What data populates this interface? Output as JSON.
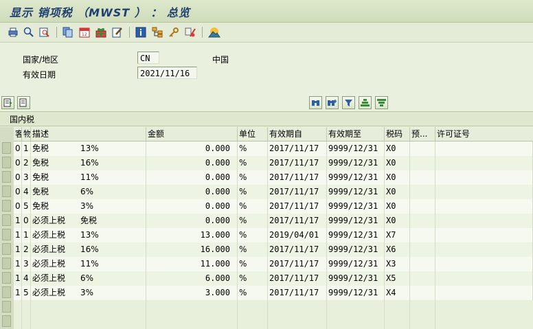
{
  "title": "显示 销项税 （MWST ） ： 总览",
  "toolbar": {
    "icons": [
      "print-icon",
      "find-icon",
      "find-next-icon",
      "copy-icon",
      "calendar-icon",
      "gift-icon",
      "edit-icon",
      "info-icon",
      "structure-icon",
      "key-icon",
      "calculate-icon",
      "mountain-icon"
    ]
  },
  "form": {
    "country_label": "国家/地区",
    "country_value": "CN",
    "country_name": "中国",
    "date_label": "有效日期",
    "date_value": "2021/11/16"
  },
  "section_title": "国内税",
  "columns": {
    "c1": "客",
    "c2": "物",
    "desc": "描述",
    "amount": "金额",
    "unit": "单位",
    "valid_from": "有效期自",
    "valid_to": "有效期至",
    "tax_code": "税码",
    "pre": "预...",
    "license": "许可证号"
  },
  "rows": [
    {
      "c1": "0",
      "c2": "1",
      "d1": "免税",
      "d2": "13%",
      "amount": "0.000",
      "unit": "%",
      "from": "2017/11/17",
      "to": "9999/12/31",
      "code": "X0"
    },
    {
      "c1": "0",
      "c2": "2",
      "d1": "免税",
      "d2": "16%",
      "amount": "0.000",
      "unit": "%",
      "from": "2017/11/17",
      "to": "9999/12/31",
      "code": "X0"
    },
    {
      "c1": "0",
      "c2": "3",
      "d1": "免税",
      "d2": "11%",
      "amount": "0.000",
      "unit": "%",
      "from": "2017/11/17",
      "to": "9999/12/31",
      "code": "X0"
    },
    {
      "c1": "0",
      "c2": "4",
      "d1": "免税",
      "d2": "6%",
      "amount": "0.000",
      "unit": "%",
      "from": "2017/11/17",
      "to": "9999/12/31",
      "code": "X0"
    },
    {
      "c1": "0",
      "c2": "5",
      "d1": "免税",
      "d2": "3%",
      "amount": "0.000",
      "unit": "%",
      "from": "2017/11/17",
      "to": "9999/12/31",
      "code": "X0"
    },
    {
      "c1": "1",
      "c2": "0",
      "d1": "必须上税",
      "d2": "免税",
      "amount": "0.000",
      "unit": "%",
      "from": "2017/11/17",
      "to": "9999/12/31",
      "code": "X0"
    },
    {
      "c1": "1",
      "c2": "1",
      "d1": "必须上税",
      "d2": "13%",
      "amount": "13.000",
      "unit": "%",
      "from": "2019/04/01",
      "to": "9999/12/31",
      "code": "X7"
    },
    {
      "c1": "1",
      "c2": "2",
      "d1": "必须上税",
      "d2": "16%",
      "amount": "16.000",
      "unit": "%",
      "from": "2017/11/17",
      "to": "9999/12/31",
      "code": "X6"
    },
    {
      "c1": "1",
      "c2": "3",
      "d1": "必须上税",
      "d2": "11%",
      "amount": "11.000",
      "unit": "%",
      "from": "2017/11/17",
      "to": "9999/12/31",
      "code": "X3"
    },
    {
      "c1": "1",
      "c2": "4",
      "d1": "必须上税",
      "d2": "6%",
      "amount": "6.000",
      "unit": "%",
      "from": "2017/11/17",
      "to": "9999/12/31",
      "code": "X5"
    },
    {
      "c1": "1",
      "c2": "5",
      "d1": "必须上税",
      "d2": "3%",
      "amount": "3.000",
      "unit": "%",
      "from": "2017/11/17",
      "to": "9999/12/31",
      "code": "X4"
    }
  ],
  "colors": {
    "accent": "#1f3f6e",
    "row_bg": "#f6f9ef",
    "header_bg": "#e6eedb"
  }
}
